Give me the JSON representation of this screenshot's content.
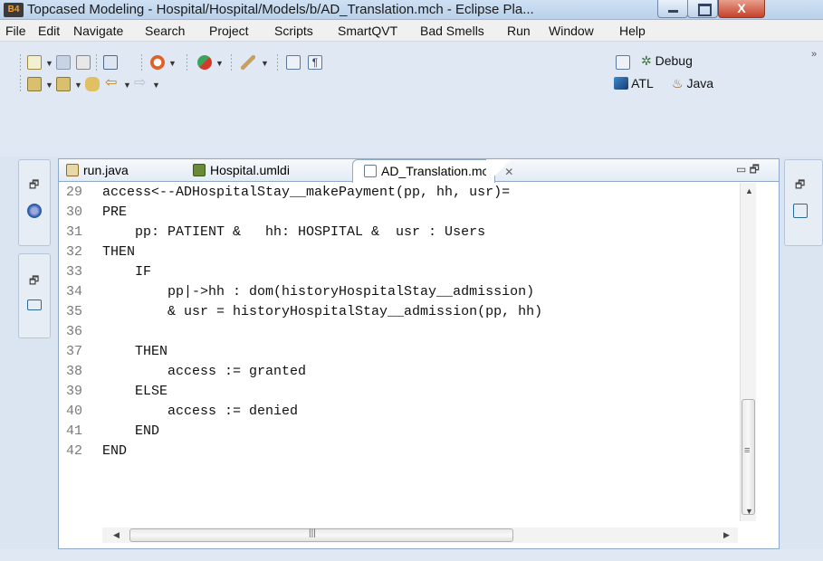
{
  "window": {
    "icon_label": "B4",
    "title": "Topcased Modeling - Hospital/Hospital/Models/b/AD_Translation.mch - Eclipse Pla...",
    "close_glyph": "X"
  },
  "menu": [
    "File",
    "Edit",
    "Navigate",
    "Search",
    "Project",
    "Scripts",
    "SmartQVT",
    "Bad Smells",
    "Run",
    "Window",
    "Help"
  ],
  "perspectives": {
    "debug": "Debug",
    "atl": "ATL",
    "java": "Java",
    "overflow": "»"
  },
  "tabs": [
    {
      "label": "run.java",
      "icon": "java-file-icon"
    },
    {
      "label": "Hospital.umldi",
      "icon": "uml-diagram-icon"
    },
    {
      "label": "AD_Translation.mch",
      "icon": "text-file-icon",
      "close": "✕",
      "active": true
    }
  ],
  "code": [
    {
      "n": "29",
      "text": "access<--ADHospitalStay__makePayment(pp, hh, usr)="
    },
    {
      "n": "30",
      "text": "PRE"
    },
    {
      "n": "31",
      "text": "    pp: PATIENT &   hh: HOSPITAL &  usr : Users"
    },
    {
      "n": "32",
      "text": "THEN"
    },
    {
      "n": "33",
      "text": "    IF"
    },
    {
      "n": "34",
      "text": "        pp|->hh : dom(historyHospitalStay__admission)"
    },
    {
      "n": "35",
      "text": "        & usr = historyHospitalStay__admission(pp, hh)"
    },
    {
      "n": "36",
      "text": ""
    },
    {
      "n": "37",
      "text": "    THEN"
    },
    {
      "n": "38",
      "text": "        access := granted"
    },
    {
      "n": "39",
      "text": "    ELSE"
    },
    {
      "n": "40",
      "text": "        access := denied"
    },
    {
      "n": "41",
      "text": "    END"
    },
    {
      "n": "42",
      "text": "END"
    }
  ],
  "colors": {
    "accent": "#3a6fb0",
    "titlebar": "#c6d9ef",
    "close": "#c5412a"
  }
}
